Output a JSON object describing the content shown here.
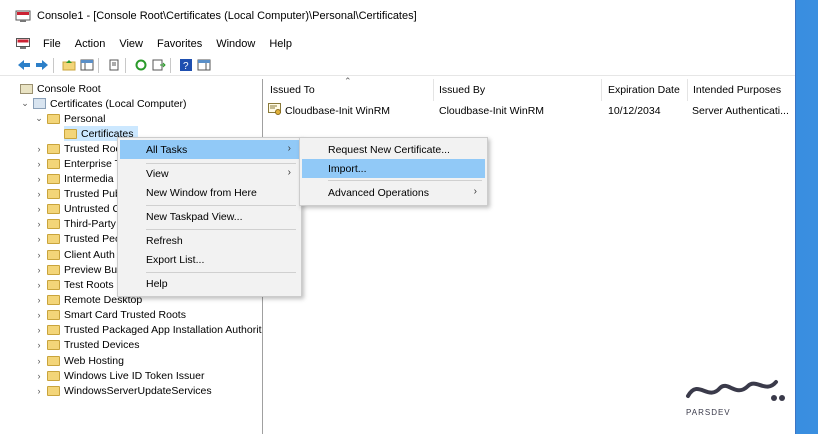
{
  "window": {
    "title": "Console1 - [Console Root\\Certificates (Local Computer)\\Personal\\Certificates]"
  },
  "menubar": {
    "items": [
      "File",
      "Action",
      "View",
      "Favorites",
      "Window",
      "Help"
    ]
  },
  "tree": {
    "root": "Console Root",
    "computer": "Certificates (Local Computer)",
    "personal": "Personal",
    "certificates": "Certificates",
    "nodes": [
      "Trusted Roo",
      "Enterprise T",
      "Intermedia",
      "Trusted Pub",
      "Untrusted C",
      "Third-Party",
      "Trusted Peo",
      "Client Auth",
      "Preview Bu",
      "Test Roots",
      "Remote Desktop",
      "Smart Card Trusted Roots",
      "Trusted Packaged App Installation Authorit",
      "Trusted Devices",
      "Web Hosting",
      "Windows Live ID Token Issuer",
      "WindowsServerUpdateServices"
    ]
  },
  "list": {
    "columns": [
      "Issued To",
      "Issued By",
      "Expiration Date",
      "Intended Purposes"
    ],
    "rows": [
      {
        "issued_to": "Cloudbase-Init WinRM",
        "issued_by": "Cloudbase-Init WinRM",
        "expiration": "10/12/2034",
        "purposes": "Server Authenticati..."
      }
    ]
  },
  "context_menu": {
    "items": [
      "All Tasks",
      "View",
      "New Window from Here",
      "New Taskpad View...",
      "Refresh",
      "Export List...",
      "Help"
    ]
  },
  "submenu": {
    "items": [
      "Request New Certificate...",
      "Import...",
      "Advanced Operations"
    ]
  },
  "watermark": {
    "text": "PARSDEV"
  }
}
